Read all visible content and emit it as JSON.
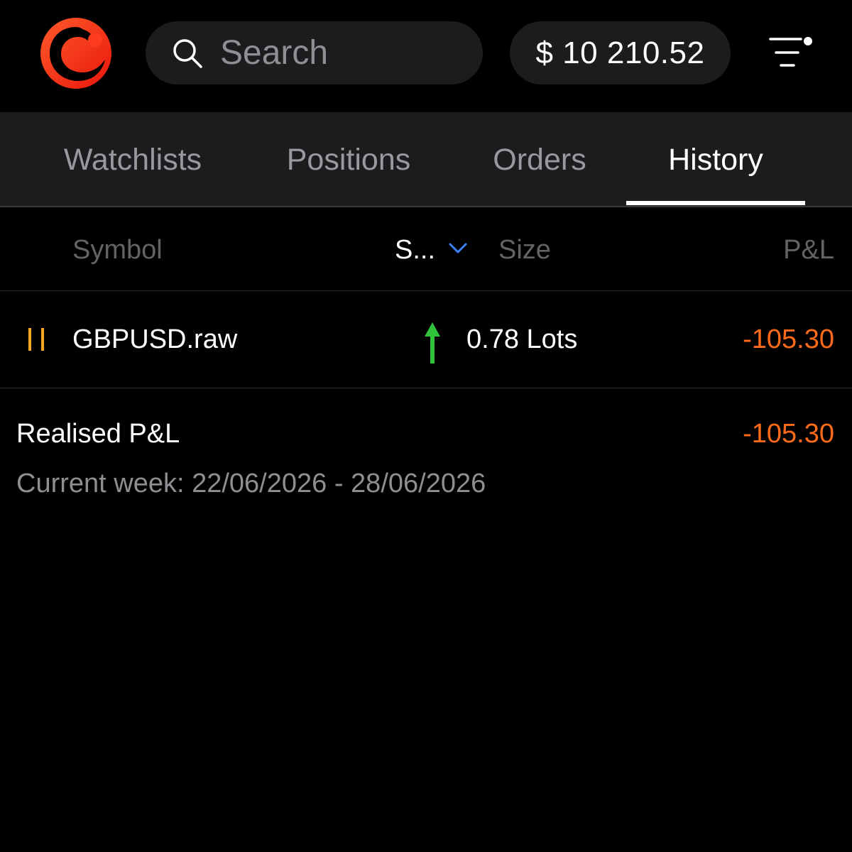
{
  "header": {
    "search_placeholder": "Search",
    "balance": "$ 10 210.52",
    "menu_has_notification": true
  },
  "tabs": [
    {
      "label": "Watchlists",
      "active": false
    },
    {
      "label": "Positions",
      "active": false
    },
    {
      "label": "Orders",
      "active": false
    },
    {
      "label": "History",
      "active": true
    }
  ],
  "table": {
    "columns": {
      "symbol": "Symbol",
      "side": "S...",
      "size": "Size",
      "pnl": "P&L"
    },
    "rows": [
      {
        "symbol": "GBPUSD.raw",
        "side": "buy",
        "size": "0.78 Lots",
        "pnl": "-105.30"
      }
    ]
  },
  "summary": {
    "label": "Realised P&L",
    "value": "-105.30",
    "period": "Current week: 22/06/2026 - 28/06/2026"
  },
  "colors": {
    "background": "#000000",
    "surface": "#1c1c1e",
    "loss": "#ff6b1a",
    "buy_arrow": "#30c23a",
    "paused_icon": "#f5a623",
    "sort_chevron": "#3b82f6",
    "brand": "#ff3b1f"
  },
  "icons": {
    "logo": "brand-logo",
    "search": "search-icon",
    "menu": "filter-menu-icon",
    "sort": "chevron-down-icon",
    "row_status": "pause-icon",
    "side": "arrow-up-icon"
  }
}
